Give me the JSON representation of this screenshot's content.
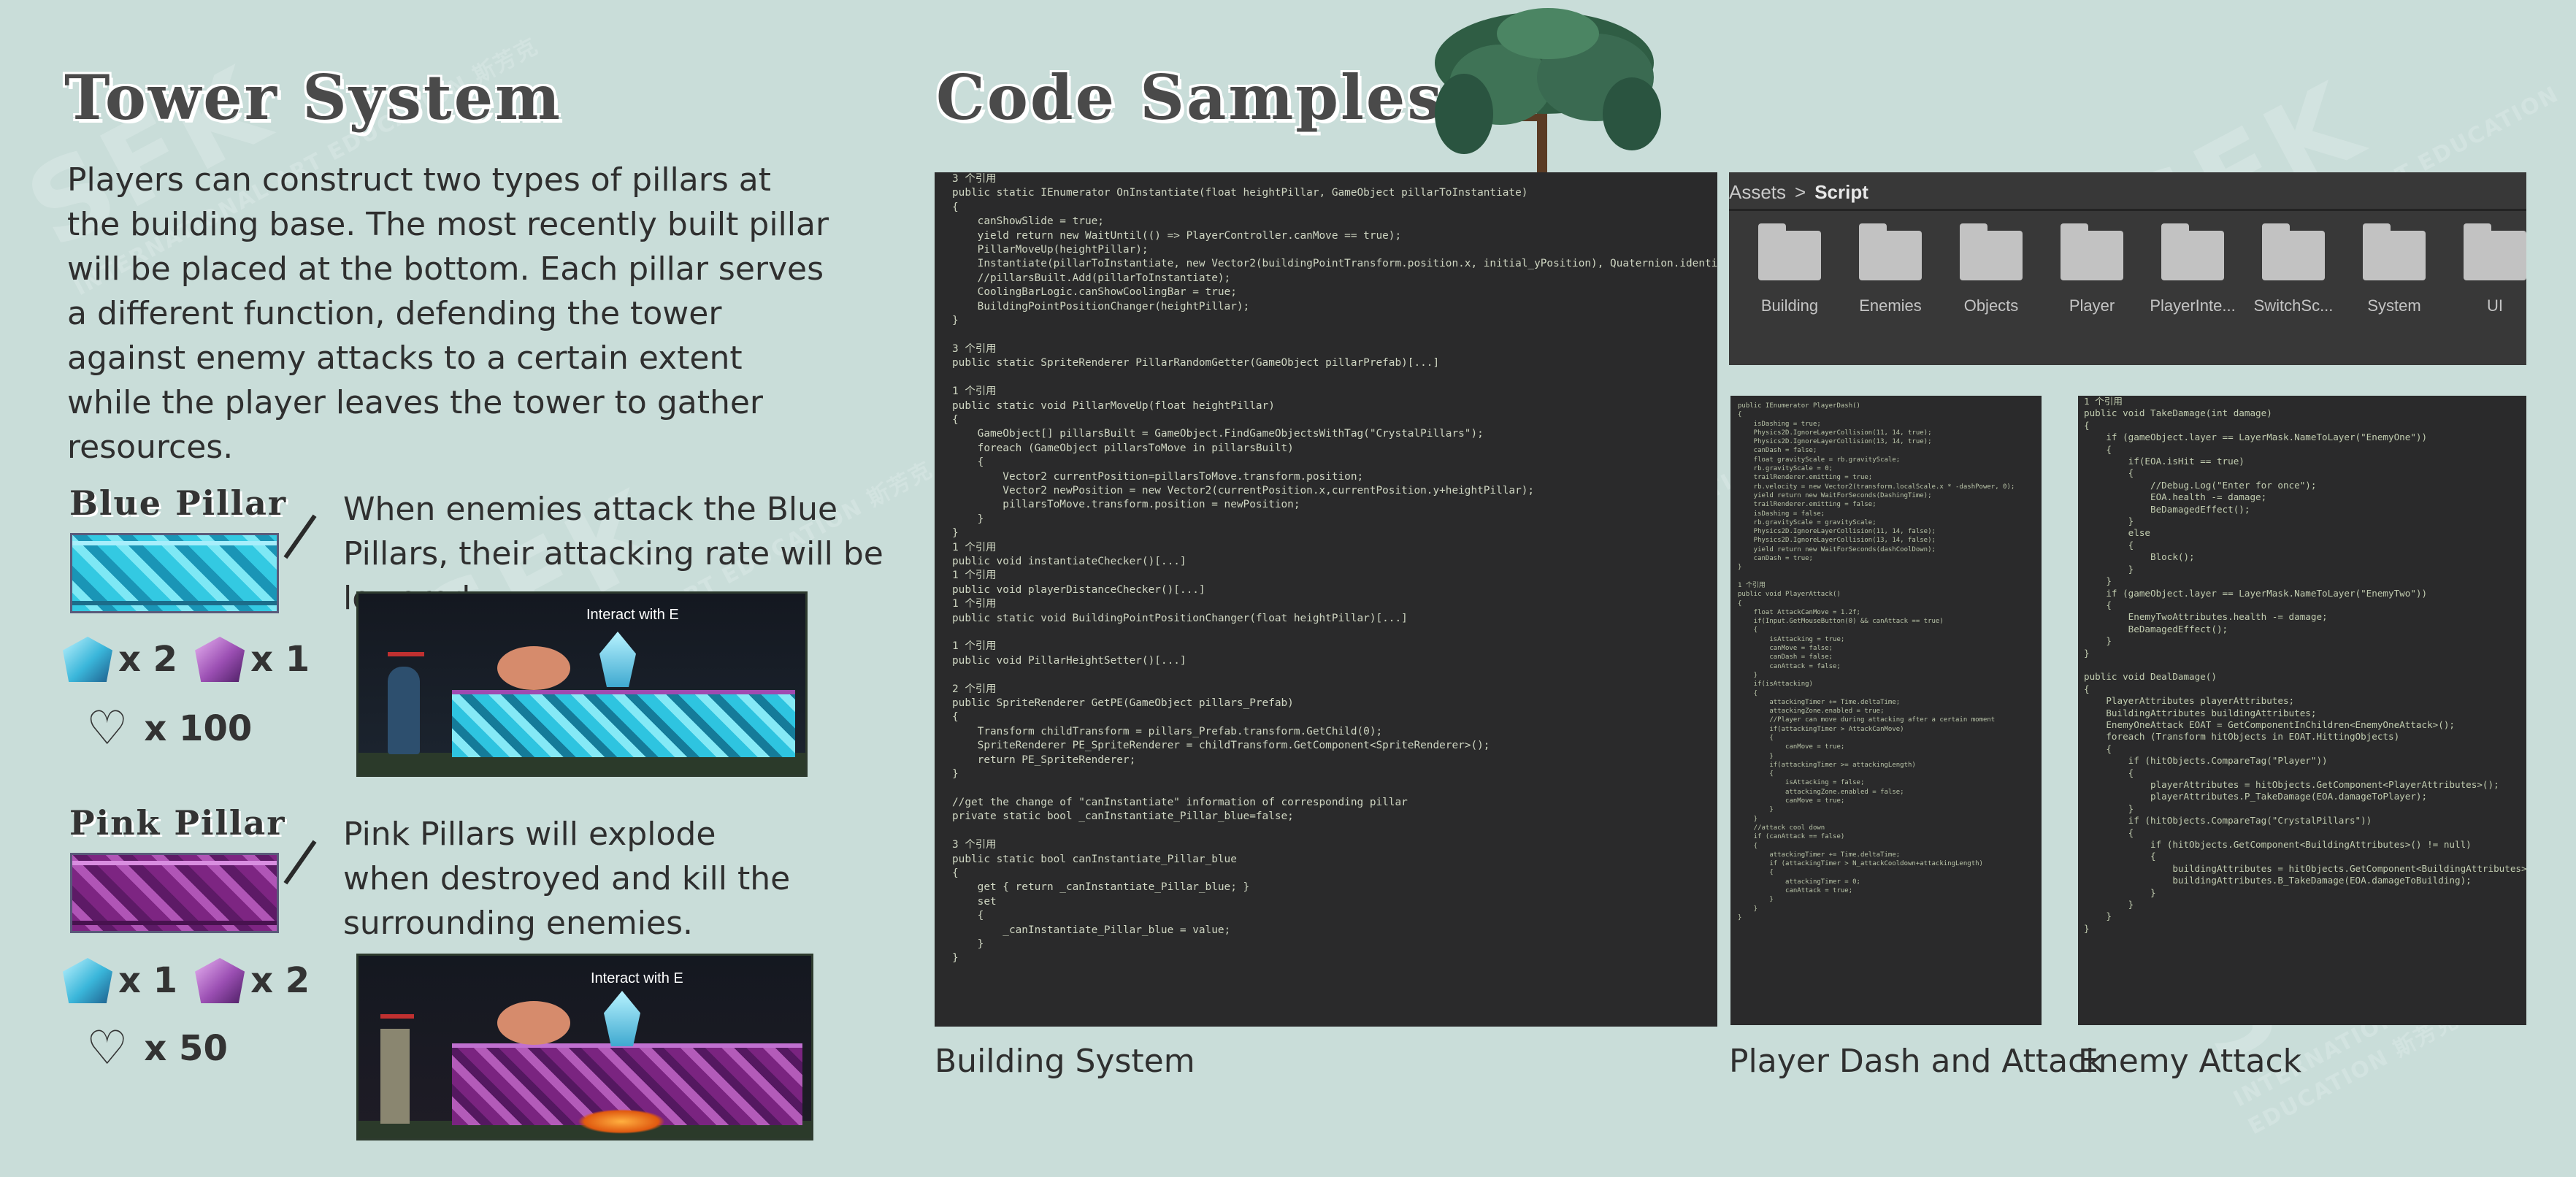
{
  "tower": {
    "title": "Tower System",
    "intro": "Players can construct two types of pillars at the building base. The most recently built pillar will be placed at the bottom. Each pillar serves a different function, defending the tower against enemy attacks to a certain extent while the player leaves the tower to gather resources.",
    "blue": {
      "title": "Blue Pillar",
      "desc": "When enemies attack the Blue Pillars, their attacking rate will be lowered.",
      "res1": "x 2",
      "res2": "x 1",
      "hp": "x 100",
      "hint": "Interact with E"
    },
    "pink": {
      "title": "Pink Pillar",
      "desc": "Pink Pillars will explode when destroyed and kill the surrounding enemies.",
      "res1": "x 1",
      "res2": "x 2",
      "hp": "x 50",
      "hint": "Interact with E"
    },
    "icons": [
      "blue-crystal-icon",
      "pink-crystal-icon",
      "heart-icon"
    ]
  },
  "code": {
    "title": "Code Samples",
    "building_caption": "Building System",
    "dash_caption": "Player Dash and Attack",
    "enemy_caption": "Enemy Attack",
    "building_code": "3 个引用\npublic static IEnumerator OnInstantiate(float heightPillar, GameObject pillarToInstantiate)\n{\n    canShowSlide = true;\n    yield return new WaitUntil(() => PlayerController.canMove == true);\n    PillarMoveUp(heightPillar);\n    Instantiate(pillarToInstantiate, new Vector2(buildingPointTransform.position.x, initial_yPosition), Quaternion.identity);\n    //pillarsBuilt.Add(pillarToInstantiate);\n    CoolingBarLogic.canShowCoolingBar = true;\n    BuildingPointPositionChanger(heightPillar);\n}\n\n3 个引用\npublic static SpriteRenderer PillarRandomGetter(GameObject pillarPrefab)[...]\n\n1 个引用\npublic static void PillarMoveUp(float heightPillar)\n{\n    GameObject[] pillarsBuilt = GameObject.FindGameObjectsWithTag(\"CrystalPillars\");\n    foreach (GameObject pillarsToMove in pillarsBuilt)\n    {\n        Vector2 currentPosition=pillarsToMove.transform.position;\n        Vector2 newPosition = new Vector2(currentPosition.x,currentPosition.y+heightPillar);\n        pillarsToMove.transform.position = newPosition;\n    }\n}\n1 个引用\npublic void instantiateChecker()[...]\n1 个引用\npublic void playerDistanceChecker()[...]\n1 个引用\npublic static void BuildingPointPositionChanger(float heightPillar)[...]\n\n1 个引用\npublic void PillarHeightSetter()[...]\n\n2 个引用\npublic SpriteRenderer GetPE(GameObject pillars_Prefab)\n{\n    Transform childTransform = pillars_Prefab.transform.GetChild(0);\n    SpriteRenderer PE_SpriteRenderer = childTransform.GetComponent<SpriteRenderer>();\n    return PE_SpriteRenderer;\n}\n\n//get the change of \"canInstantiate\" information of corresponding pillar\nprivate static bool _canInstantiate_Pillar_blue=false;\n\n3 个引用\npublic static bool canInstantiate_Pillar_blue\n{\n    get { return _canInstantiate_Pillar_blue; }\n    set\n    {\n        _canInstantiate_Pillar_blue = value;\n    }\n}",
    "dash_code": "public IEnumerator PlayerDash()\n{\n    isDashing = true;\n    Physics2D.IgnoreLayerCollision(11, 14, true);\n    Physics2D.IgnoreLayerCollision(13, 14, true);\n    canDash = false;\n    float gravityScale = rb.gravityScale;\n    rb.gravityScale = 0;\n    trailRenderer.emitting = true;\n    rb.velocity = new Vector2(transform.localScale.x * -dashPower, 0);\n    yield return new WaitForSeconds(DashingTime);\n    trailRenderer.emitting = false;\n    isDashing = false;\n    rb.gravityScale = gravityScale;\n    Physics2D.IgnoreLayerCollision(11, 14, false);\n    Physics2D.IgnoreLayerCollision(13, 14, false);\n    yield return new WaitForSeconds(dashCoolDown);\n    canDash = true;\n}\n\n1 个引用\npublic void PlayerAttack()\n{\n    float AttackCanMove = 1.2f;\n    if(Input.GetMouseButton(0) && canAttack == true)\n    {\n        isAttacking = true;\n        canMove = false;\n        canDash = false;\n        canAttack = false;\n    }\n    if(isAttacking)\n    {\n        attackingTimer += Time.deltaTime;\n        attackingZone.enabled = true;\n        //Player can move during attacking after a certain moment\n        if(attackingTimer > AttackCanMove)\n        {\n            canMove = true;\n        }\n        if(attackingTimer >= attackingLength)\n        {\n            isAttacking = false;\n            attackingZone.enabled = false;\n            canMove = true;\n        }\n    }\n    //attack cool down\n    if (canAttack == false)\n    {\n        attackingTimer += Time.deltaTime;\n        if (attackingTimer > N_attackCooldown+attackingLength)\n        {\n            attackingTimer = 0;\n            canAttack = true;\n        }\n    }\n}",
    "enemy_code": "1 个引用\npublic void TakeDamage(int damage)\n{\n    if (gameObject.layer == LayerMask.NameToLayer(\"EnemyOne\"))\n    {\n        if(EOA.isHit == true)\n        {\n            //Debug.Log(\"Enter for once\");\n            EOA.health -= damage;\n            BeDamagedEffect();\n        }\n        else\n        {\n            Block();\n        }\n    }\n    if (gameObject.layer == LayerMask.NameToLayer(\"EnemyTwo\"))\n    {\n        EnemyTwoAttributes.health -= damage;\n        BeDamagedEffect();\n    }\n}\n\npublic void DealDamage()\n{\n    PlayerAttributes playerAttributes;\n    BuildingAttributes buildingAttributes;\n    EnemyOneAttack EOAT = GetComponentInChildren<EnemyOneAttack>();\n    foreach (Transform hitObjects in EOAT.HittingObjects)\n    {\n        if (hitObjects.CompareTag(\"Player\"))\n        {\n            playerAttributes = hitObjects.GetComponent<PlayerAttributes>();\n            playerAttributes.P_TakeDamage(EOA.damageToPlayer);\n        }\n        if (hitObjects.CompareTag(\"CrystalPillars\"))\n        {\n            if (hitObjects.GetComponent<BuildingAttributes>() != null)\n            {\n                buildingAttributes = hitObjects.GetComponent<BuildingAttributes>();\n                buildingAttributes.B_TakeDamage(EOA.damageToBuilding);\n            }\n        }\n    }\n}"
  },
  "explorer": {
    "path_root": "Assets",
    "path_sep": ">",
    "path_current": "Script",
    "folders": [
      "Building",
      "Enemies",
      "Objects",
      "Player",
      "PlayerInte...",
      "SwitchSc...",
      "System",
      "UI"
    ]
  },
  "watermark": {
    "text": "SFK",
    "sub": "INTERNATIONAL ART EDUCATION 斯芳克"
  },
  "colors": {
    "background": "#c9ddd9",
    "code_bg": "#2a2a2b",
    "explorer_bg": "#383838",
    "blue_pillar": "#2fc6e0",
    "pink_pillar": "#8a2b8e"
  }
}
